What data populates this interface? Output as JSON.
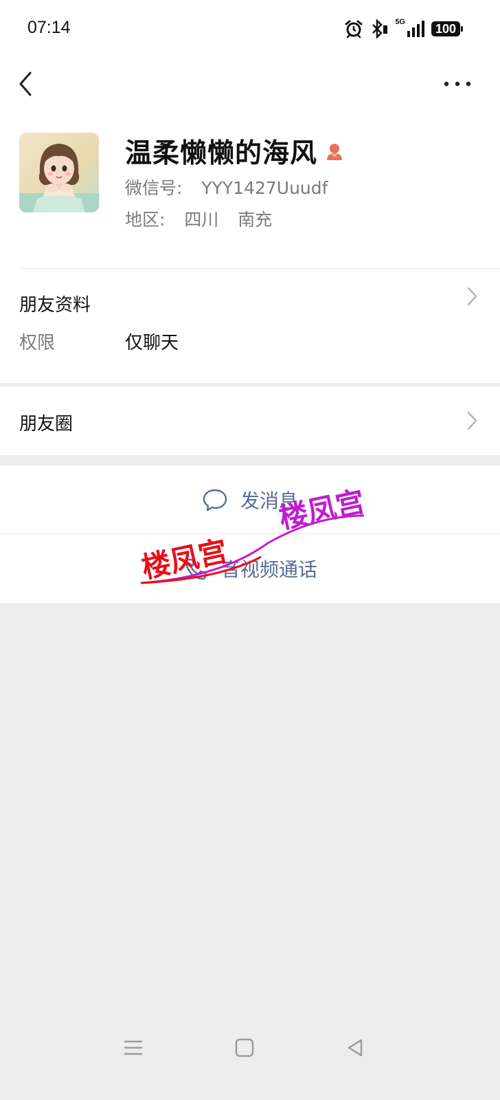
{
  "status_bar": {
    "time": "07:14",
    "network": "5G",
    "battery": "100",
    "icons": [
      "alarm-icon",
      "bluetooth-icon",
      "signal-icon",
      "battery-icon"
    ]
  },
  "nav": {
    "back_icon": "chevron-left-icon",
    "more_icon": "more-horizontal-icon"
  },
  "profile": {
    "name": "温柔懒懒的海风",
    "gender_icon": "female-icon",
    "gender_color": "#e8735a",
    "wechat_id_label": "微信号:",
    "wechat_id": "YYY1427Uuudf",
    "region_label": "地区:",
    "region_province": "四川",
    "region_city": "南充"
  },
  "friend_info": {
    "title": "朋友资料",
    "permission_label": "权限",
    "permission_value": "仅聊天"
  },
  "moments": {
    "title": "朋友圈"
  },
  "actions": {
    "send_message": "发消息",
    "video_call": "音视频通话",
    "accent_color": "#576b95"
  },
  "watermark": {
    "text_1": "楼凤宫",
    "text_2": "楼凤宫"
  },
  "system_nav": {
    "menu_icon": "menu-icon",
    "home_icon": "home-square-icon",
    "back_icon": "back-triangle-icon"
  }
}
